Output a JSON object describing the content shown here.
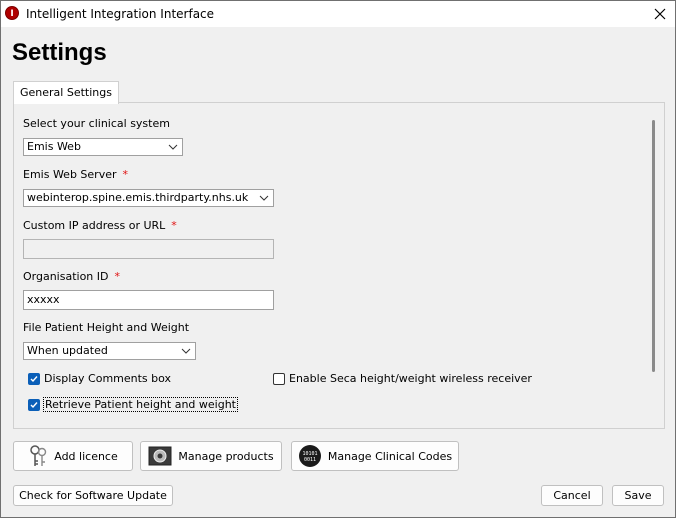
{
  "window": {
    "title": "Intelligent Integration Interface",
    "app_icon_letter": "I"
  },
  "heading": "Settings",
  "tab": {
    "label": "General Settings"
  },
  "form": {
    "clinical_system": {
      "label": "Select your clinical system",
      "value": "Emis Web"
    },
    "web_server": {
      "label": "Emis Web Server",
      "required_mark": "*",
      "value": "webinterop.spine.emis.thirdparty.nhs.uk"
    },
    "custom_ip": {
      "label": "Custom IP address or URL",
      "required_mark": "*",
      "value": ""
    },
    "org_id": {
      "label": "Organisation ID",
      "required_mark": "*",
      "value": "xxxxx"
    },
    "height_weight": {
      "label": "File Patient Height and Weight",
      "value": "When updated"
    },
    "display_comments": {
      "label": "Display Comments box",
      "checked": true
    },
    "seca": {
      "label": "Enable Seca height/weight wireless receiver",
      "checked": false
    },
    "retrieve_hw": {
      "label": "Retrieve Patient height and weight",
      "checked": true
    }
  },
  "buttons": {
    "add_licence": "Add licence",
    "manage_products": "Manage products",
    "manage_codes": "Manage Clinical Codes",
    "check_update": "Check for Software Update",
    "cancel": "Cancel",
    "save": "Save"
  },
  "icons": {
    "app": "app-logo-icon",
    "close": "close-icon",
    "keys": "keys-icon",
    "products": "products-icon",
    "codes": "binary-codes-icon",
    "chevron": "chevron-down-icon",
    "check": "checkmark-icon"
  },
  "colors": {
    "checkbox_accent": "#0b5fb8",
    "required": "#e01010",
    "app_icon": "#b00000"
  }
}
